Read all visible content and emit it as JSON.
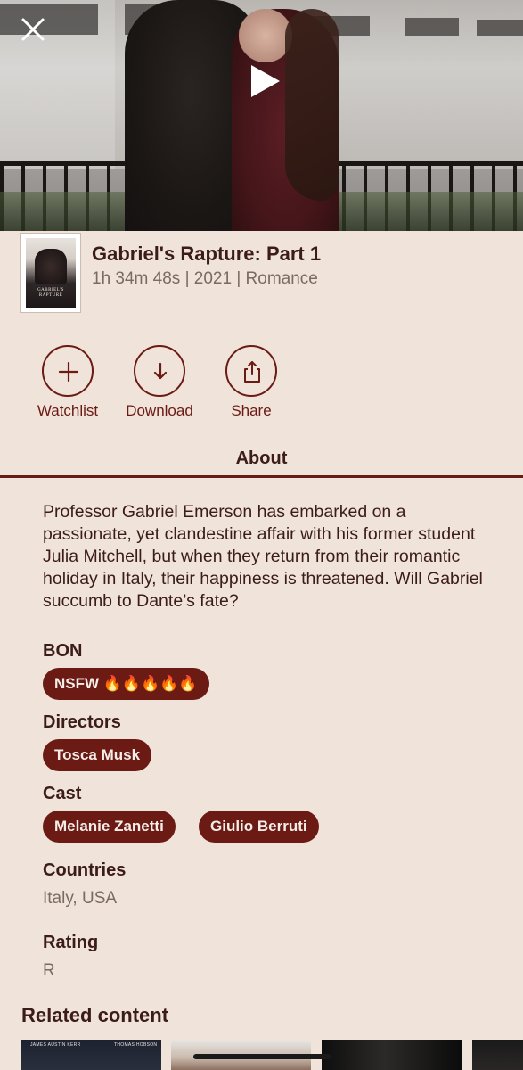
{
  "movie": {
    "title": "Gabriel's Rapture: Part 1",
    "meta": "1h 34m 48s | 2021 | Romance",
    "poster_text": "GABRIEL'S RAPTURE"
  },
  "actions": [
    {
      "label": "Watchlist",
      "icon": "plus-icon"
    },
    {
      "label": "Download",
      "icon": "download-arrow-icon"
    },
    {
      "label": "Share",
      "icon": "share-icon"
    }
  ],
  "tabs": {
    "about": "About"
  },
  "description": "Professor Gabriel Emerson has embarked on a passionate, yet clandestine affair with his former student Julia Mitchell, but when they return from their romantic holiday in Italy, their happiness is threatened. Will Gabriel succumb to Dante’s fate?",
  "bon": {
    "label": "BON",
    "chip": "NSFW 🔥🔥🔥🔥🔥"
  },
  "directors": {
    "label": "Directors",
    "items": [
      "Tosca Musk"
    ]
  },
  "cast": {
    "label": "Cast",
    "items": [
      "Melanie Zanetti",
      "Giulio Berruti"
    ]
  },
  "countries": {
    "label": "Countries",
    "value": "Italy, USA"
  },
  "rating": {
    "label": "Rating",
    "value": "R"
  },
  "related": {
    "title": "Related content",
    "thumb_captions": [
      "JAMES AUSTIN KERR",
      "THOMAS HOBSON"
    ]
  },
  "colors": {
    "accent": "#6B1A14",
    "background": "#EFE3DA",
    "text": "#3C1C18",
    "muted": "#7A6A64"
  }
}
